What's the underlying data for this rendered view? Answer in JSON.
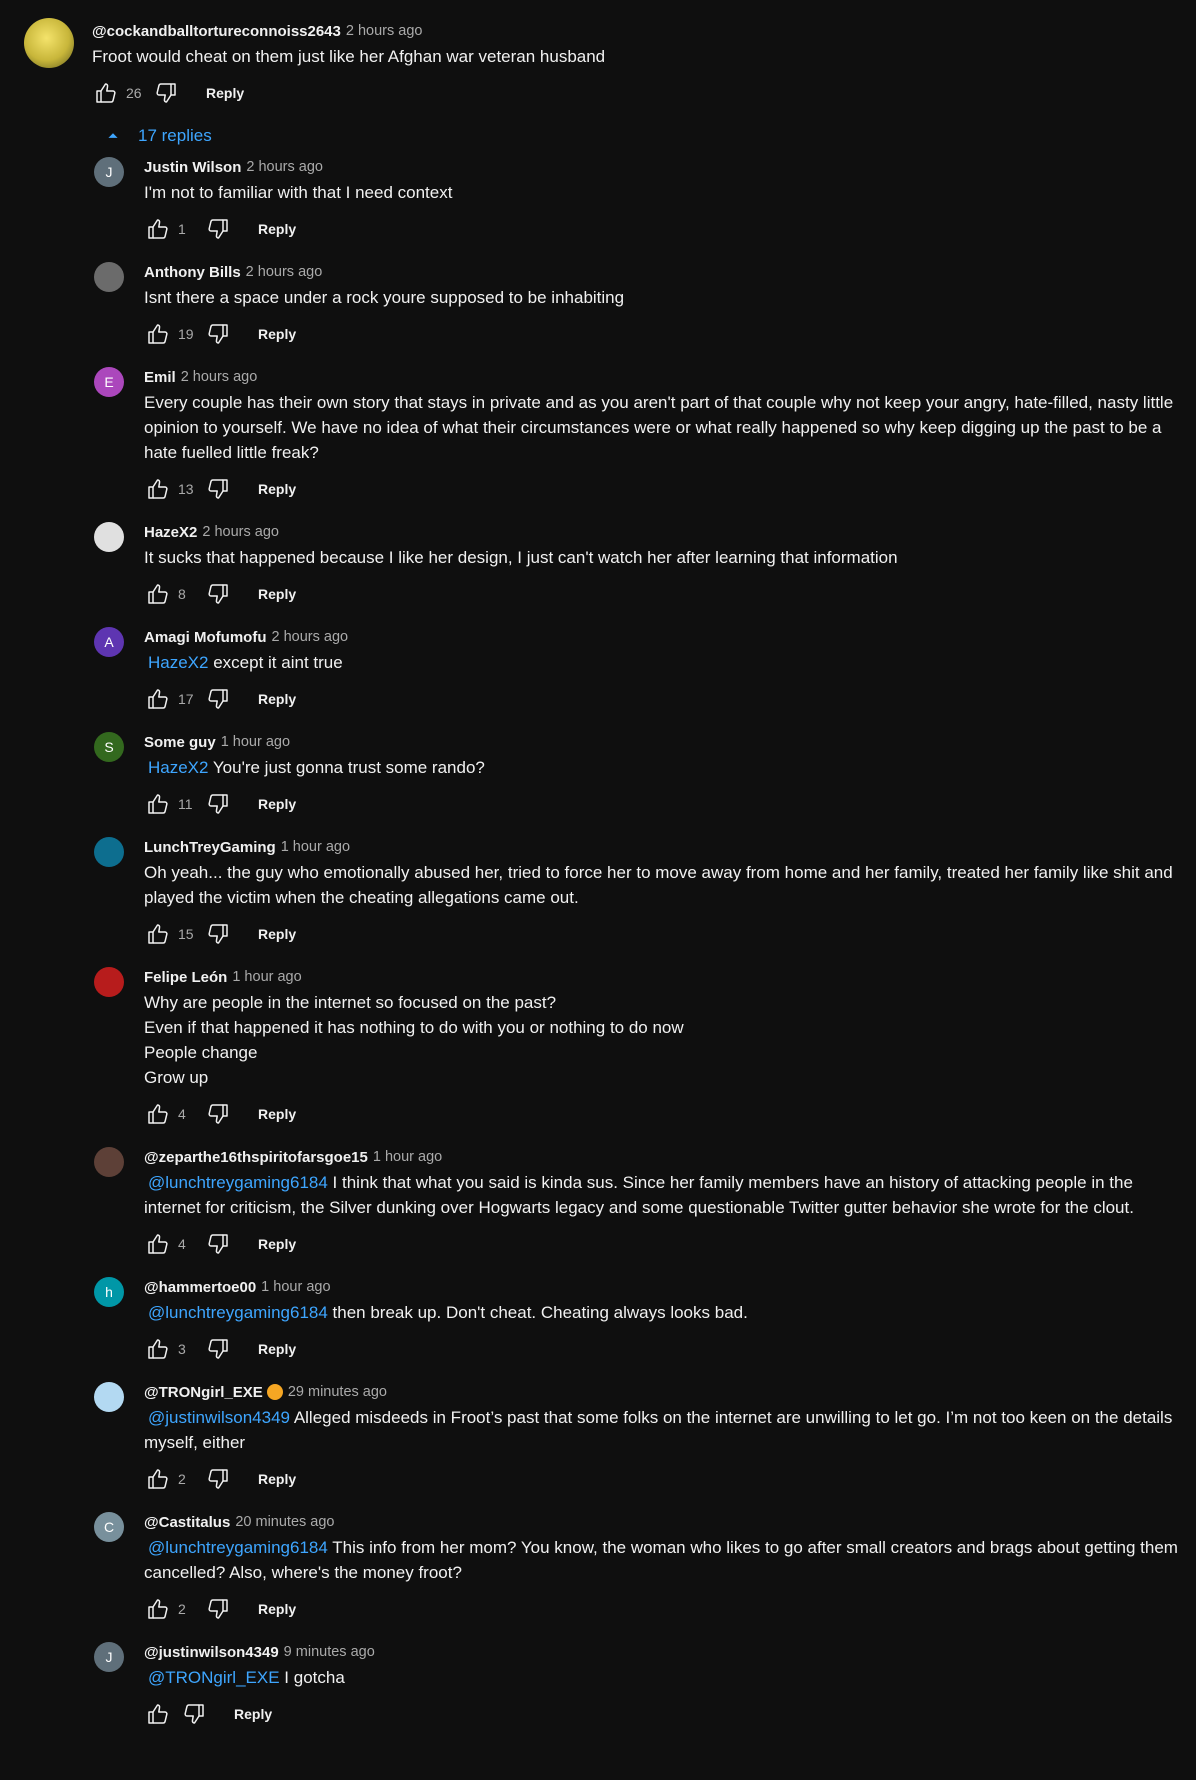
{
  "parent": {
    "author": "@cockandballtortureconnoiss2643",
    "time": "2 hours ago",
    "text": "Froot would cheat on them just like her Afghan war veteran husband",
    "likes": "26",
    "reply_label": "Reply",
    "avatar_icon": "cartoon-avatar-icon"
  },
  "replies_toggle": {
    "label": "17 replies",
    "icon": "chevron-up-icon",
    "color": "#3ea6ff"
  },
  "replies": [
    {
      "author": "Justin Wilson",
      "time": "2 hours ago",
      "avatar_letter": "J",
      "avatar_color": "#5f6f7a",
      "mention": "",
      "text": "I'm not to familiar with that I need context",
      "likes": "1",
      "reply_label": "Reply"
    },
    {
      "author": "Anthony Bills",
      "time": "2 hours ago",
      "avatar_letter": "",
      "avatar_color": "#6b6b6b",
      "mention": "",
      "text": "Isnt there a space under a rock youre supposed to be inhabiting",
      "likes": "19",
      "reply_label": "Reply"
    },
    {
      "author": "Emil",
      "time": "2 hours ago",
      "avatar_letter": "E",
      "avatar_color": "#ab47bc",
      "mention": "",
      "text": "Every couple has their own story that stays in private and as you aren't part of that couple why not keep your angry, hate-filled, nasty little opinion to yourself.   We have no idea of what their circumstances were or what really happened so why keep digging up the past to be a hate fuelled little freak?",
      "likes": "13",
      "reply_label": "Reply"
    },
    {
      "author": "HazeX2",
      "time": "2 hours ago",
      "avatar_letter": "",
      "avatar_color": "#e0e0e0",
      "mention": "",
      "text": "It sucks that happened because I like her design, I just can't watch her after learning that information",
      "likes": "8",
      "reply_label": "Reply"
    },
    {
      "author": "Amagi Mofumofu",
      "time": "2 hours ago",
      "avatar_letter": "A",
      "avatar_color": "#5e35b1",
      "mention": "HazeX2",
      "text": " except it aint true",
      "likes": "17",
      "reply_label": "Reply"
    },
    {
      "author": "Some guy",
      "time": "1 hour ago",
      "avatar_letter": "S",
      "avatar_color": "#33691e",
      "mention": "HazeX2",
      "text": "You're just gonna trust some rando?",
      "likes": "11",
      "reply_label": "Reply"
    },
    {
      "author": "LunchTreyGaming",
      "time": "1 hour ago",
      "avatar_letter": "",
      "avatar_color": "#0d6e8f",
      "mention": "",
      "text": "Oh yeah... the guy who emotionally abused her, tried to force her to move away from home and her family, treated her family like shit and played the victim when the cheating allegations came out.",
      "likes": "15",
      "reply_label": "Reply"
    },
    {
      "author": "Felipe León",
      "time": "1 hour ago",
      "avatar_letter": "",
      "avatar_color": "#b71c1c",
      "mention": "",
      "text": "Why are people in the internet so focused on the past?\nEven if that happened it has nothing to do with you or nothing to do now\nPeople change\nGrow up",
      "likes": "4",
      "reply_label": "Reply"
    },
    {
      "author": "@zeparthe16thspiritofarsgoe15",
      "time": "1 hour ago",
      "avatar_letter": "",
      "avatar_color": "#5d4037",
      "mention": "@lunchtreygaming6184",
      "text": "I think that what you said is kinda sus. Since her family members have an history of attacking people in the internet for criticism, the Silver dunking over Hogwarts legacy and some questionable Twitter gutter behavior she wrote for the clout.",
      "likes": "4",
      "reply_label": "Reply"
    },
    {
      "author": "@hammertoe00",
      "time": "1 hour ago",
      "avatar_letter": "h",
      "avatar_color": "#0097a7",
      "mention": "@lunchtreygaming6184",
      "text": "then break up. Don't cheat. Cheating always looks bad.",
      "likes": "3",
      "reply_label": "Reply"
    },
    {
      "author": "@TRONgirl_EXE",
      "time": "29 minutes ago",
      "avatar_letter": "",
      "avatar_color": "#b3d9f2",
      "badge": true,
      "mention": "@justinwilson4349",
      "text": " Alleged misdeeds in Froot’s past that some folks on the internet are unwilling to let go. I’m not too keen on the details myself, either",
      "likes": "2",
      "reply_label": "Reply"
    },
    {
      "author": "@Castitalus",
      "time": "20 minutes ago",
      "avatar_letter": "C",
      "avatar_color": "#78909c",
      "mention": "@lunchtreygaming6184",
      "text": " This info from her mom? You know, the woman who likes to go after small creators and brags about getting them cancelled? Also, where's the money froot?",
      "likes": "2",
      "reply_label": "Reply"
    },
    {
      "author": "@justinwilson4349",
      "time": "9 minutes ago",
      "avatar_letter": "J",
      "avatar_color": "#5f6f7a",
      "mention": "@TRONgirl_EXE",
      "text": "I gotcha",
      "likes": "",
      "reply_label": "Reply"
    }
  ]
}
